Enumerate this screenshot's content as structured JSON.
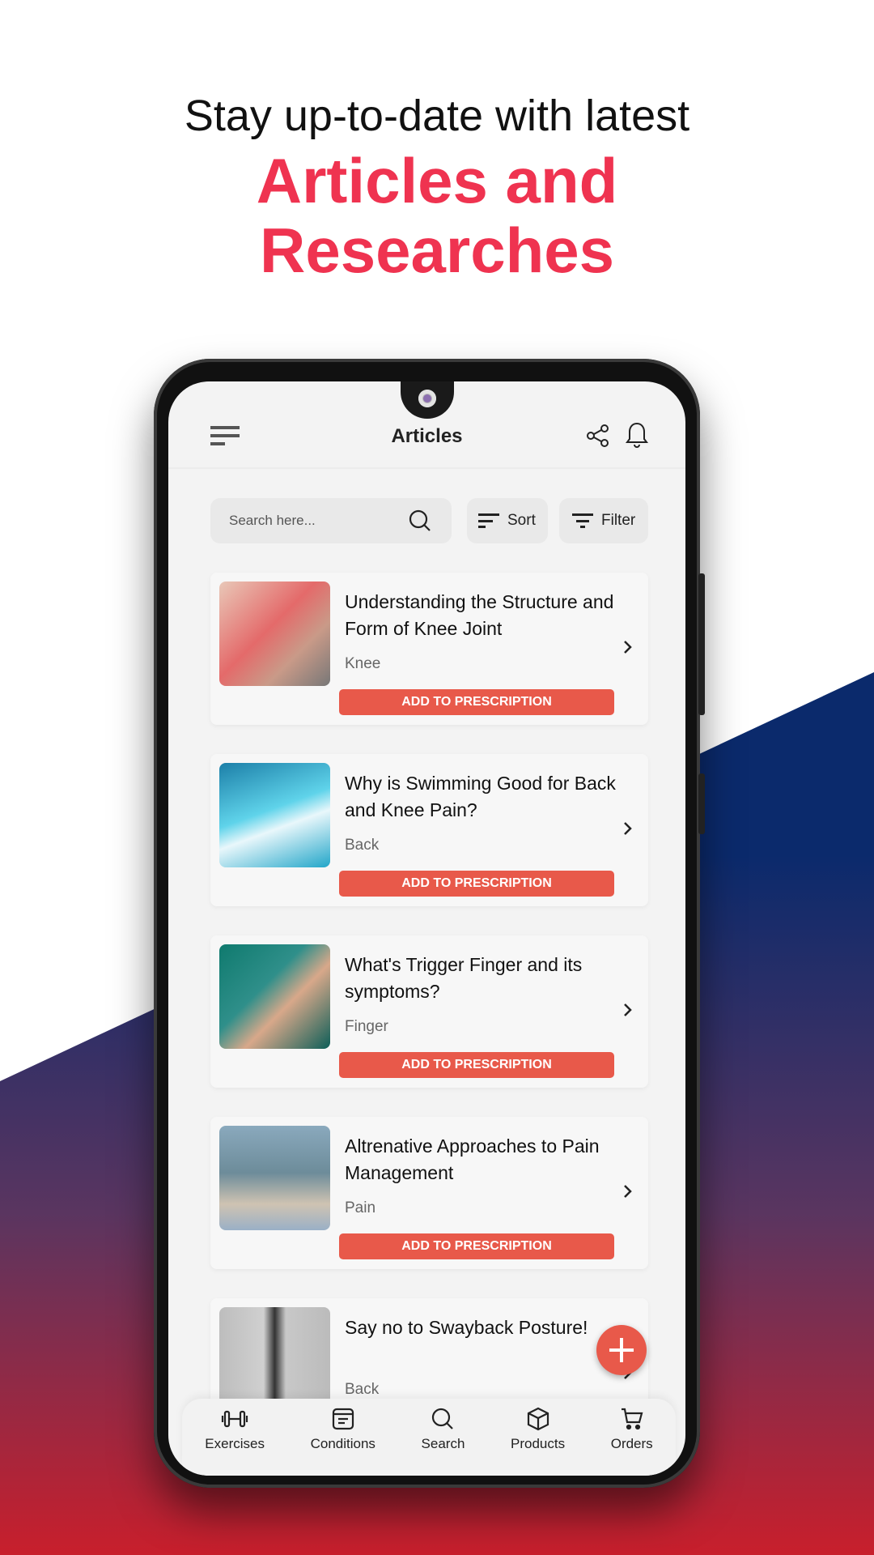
{
  "headline": {
    "line1": "Stay up-to-date with latest",
    "line2": "Articles and",
    "line3": "Researches",
    "accent": "#ef3350"
  },
  "app": {
    "title": "Articles",
    "search_placeholder": "Search here...",
    "sort_label": "Sort",
    "filter_label": "Filter"
  },
  "articles": [
    {
      "title": "Understanding the Structure and Form of Knee Joint",
      "tag": "Knee",
      "button": "ADD TO PRESCRIPTION"
    },
    {
      "title": "Why is Swimming Good for Back and Knee Pain?",
      "tag": "Back",
      "button": "ADD TO PRESCRIPTION"
    },
    {
      "title": "What's Trigger Finger and its symptoms?",
      "tag": "Finger",
      "button": "ADD TO PRESCRIPTION"
    },
    {
      "title": "Altrenative Approaches to Pain Management",
      "tag": "Pain",
      "button": "ADD TO PRESCRIPTION"
    },
    {
      "title": "Say no to Swayback Posture!",
      "tag": "Back"
    }
  ],
  "nav": [
    {
      "label": "Exercises",
      "icon": "dumbbell-icon"
    },
    {
      "label": "Conditions",
      "icon": "browser-list-icon"
    },
    {
      "label": "Search",
      "icon": "search-icon"
    },
    {
      "label": "Products",
      "icon": "box-icon"
    },
    {
      "label": "Orders",
      "icon": "cart-icon"
    }
  ],
  "colors": {
    "button": "#e8594a",
    "navy": "#0b2a6c",
    "red": "#c81f2c"
  }
}
